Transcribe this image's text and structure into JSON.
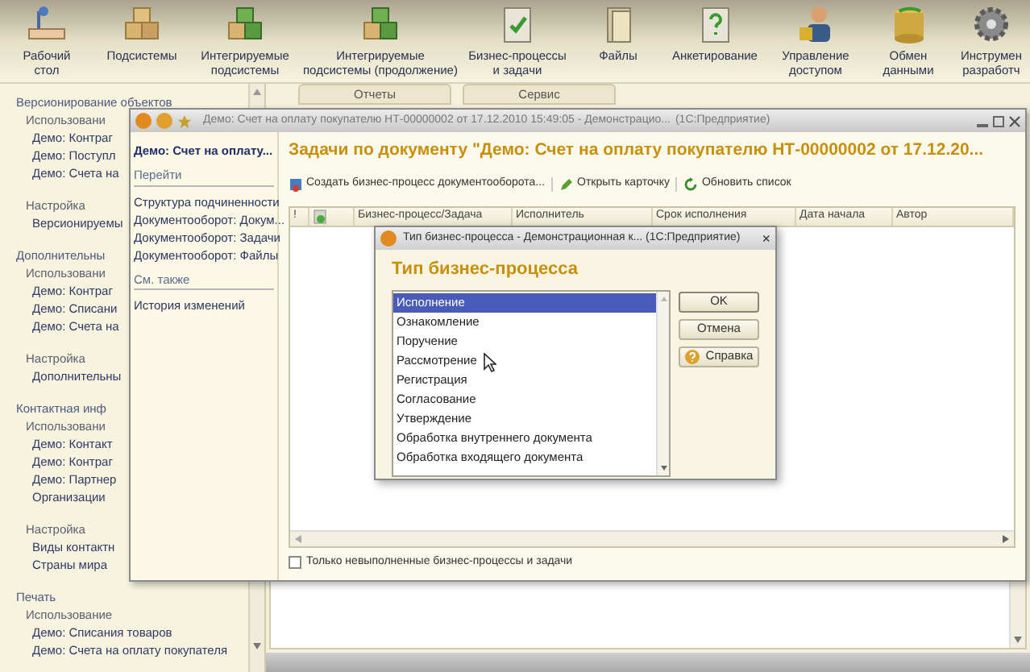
{
  "toolbar": {
    "items": [
      {
        "label": "Рабочий\nстол"
      },
      {
        "label": "Подсистемы"
      },
      {
        "label": "Интегрируемые\nподсистемы"
      },
      {
        "label": "Интегрируемые\nподсистемы (продолжение)"
      },
      {
        "label": "Бизнес-процессы\nи задачи"
      },
      {
        "label": "Файлы"
      },
      {
        "label": "Анкетирование"
      },
      {
        "label": "Управление\nдоступом"
      },
      {
        "label": "Обмен\nданными"
      },
      {
        "label": "Инструмен\nразработч"
      }
    ]
  },
  "tabs": [
    {
      "label": "Отчеты"
    },
    {
      "label": "Сервис"
    }
  ],
  "sidebar": {
    "groups": [
      {
        "title": "Версионирование объектов",
        "children": [
          {
            "title": "Использовани",
            "children": [
              {
                "title": "Демо: Контраг"
              },
              {
                "title": "Демо: Поступл"
              },
              {
                "title": "Демо: Счета на"
              }
            ]
          },
          {
            "title": "Настройка",
            "children": [
              {
                "title": "Версионируемы"
              }
            ]
          }
        ]
      },
      {
        "title": "Дополнительны",
        "children": [
          {
            "title": "Использовани",
            "children": [
              {
                "title": "Демо: Контраг"
              },
              {
                "title": "Демо: Списани"
              },
              {
                "title": "Демо: Счета на"
              }
            ]
          },
          {
            "title": "Настройка",
            "children": [
              {
                "title": "Дополнительны"
              }
            ]
          }
        ]
      },
      {
        "title": "Контактная инф",
        "children": [
          {
            "title": "Использовани",
            "children": [
              {
                "title": "Демо: Контакт"
              },
              {
                "title": "Демо: Контраг"
              },
              {
                "title": "Демо: Партнер"
              },
              {
                "title": "Организации"
              }
            ]
          },
          {
            "title": "Настройка",
            "children": [
              {
                "title": "Виды контактн"
              },
              {
                "title": "Страны мира"
              }
            ]
          }
        ]
      },
      {
        "title": "Печать",
        "children": [
          {
            "title": "Использование",
            "children": [
              {
                "title": "Демо: Списания товаров"
              },
              {
                "title": "Демо: Счета на оплату покупателя"
              }
            ]
          }
        ]
      }
    ]
  },
  "document_window": {
    "title": "Демо: Счет на оплату покупателю НТ-00000002 от 17.12.2010 15:49:05 - Демонстрацио...",
    "app": "(1С:Предприятие)",
    "nav": {
      "title": "Демо: Счет на оплату...",
      "sections": [
        {
          "title": "Перейти",
          "items": [
            {
              "label": "Структура подчиненности"
            },
            {
              "label": "Документооборот: Докум..."
            },
            {
              "label": "Документооборот: Задачи"
            },
            {
              "label": "Документооборот: Файлы"
            }
          ]
        },
        {
          "title": "См. также",
          "items": [
            {
              "label": "История изменений"
            }
          ]
        }
      ]
    },
    "heading": "Задачи по документу \"Демо: Счет на оплату покупателю НТ-00000002 от 17.12.20...",
    "actions": [
      {
        "label": "Создать бизнес-процесс документооборота..."
      },
      {
        "label": "Открыть карточку"
      },
      {
        "label": "Обновить список"
      }
    ],
    "table": {
      "columns": [
        {
          "kind": "text",
          "label": "!"
        },
        {
          "kind": "icon"
        },
        {
          "kind": "text",
          "label": "Бизнес-процесс/Задача"
        },
        {
          "kind": "text",
          "label": "Исполнитель"
        },
        {
          "kind": "text",
          "label": "Срок исполнения"
        },
        {
          "kind": "text",
          "label": "Дата начала"
        },
        {
          "kind": "text",
          "label": "Автор"
        }
      ]
    },
    "filter": {
      "label": "Только невыполненные бизнес-процессы и задачи",
      "checked": false
    }
  },
  "dialog": {
    "title": "Тип бизнес-процесса - Демонстрационная к... (1С:Предприятие)",
    "close": "×",
    "heading": "Тип бизнес-процесса",
    "options": [
      {
        "label": "Исполнение",
        "selected": true
      },
      {
        "label": "Ознакомление",
        "selected": false
      },
      {
        "label": "Поручение",
        "selected": false
      },
      {
        "label": "Рассмотрение",
        "selected": false
      },
      {
        "label": "Регистрация",
        "selected": false
      },
      {
        "label": "Согласование",
        "selected": false
      },
      {
        "label": "Утверждение",
        "selected": false
      },
      {
        "label": "Обработка внутреннего документа",
        "selected": false
      },
      {
        "label": "Обработка входящего документа",
        "selected": false
      }
    ],
    "buttons": [
      {
        "label": "OK",
        "kind": "default"
      },
      {
        "label": "Отмена",
        "kind": "plain"
      },
      {
        "label": "Справка",
        "kind": "help"
      }
    ]
  }
}
